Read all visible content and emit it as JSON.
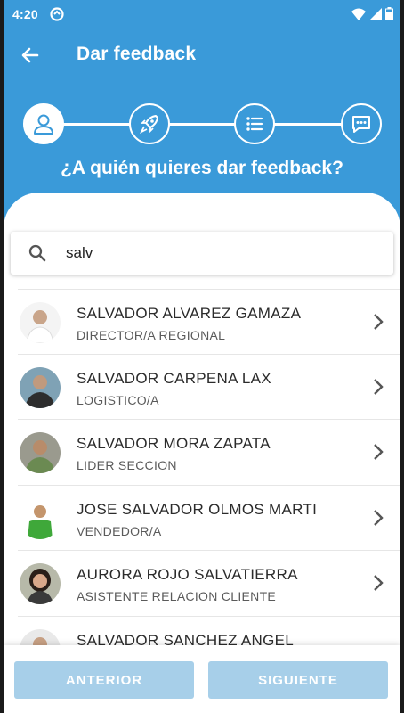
{
  "status_bar": {
    "time": "4:20"
  },
  "toolbar": {
    "title": "Dar feedback"
  },
  "stepper": {
    "steps": [
      {
        "icon": "person-icon",
        "active": true
      },
      {
        "icon": "rocket-icon",
        "active": false
      },
      {
        "icon": "list-icon",
        "active": false
      },
      {
        "icon": "chat-icon",
        "active": false
      }
    ]
  },
  "question": "¿A quién quieres dar feedback?",
  "search": {
    "value": "salv"
  },
  "people": [
    {
      "name": "SALVADOR ALVAREZ GAMAZA",
      "role": "DIRECTOR/A REGIONAL"
    },
    {
      "name": "SALVADOR CARPENA LAX",
      "role": "LOGISTICO/A"
    },
    {
      "name": "SALVADOR MORA ZAPATA",
      "role": "LIDER SECCION"
    },
    {
      "name": "JOSE SALVADOR OLMOS MARTI",
      "role": "VENDEDOR/A"
    },
    {
      "name": "AURORA ROJO SALVATIERRA",
      "role": "ASISTENTE RELACION CLIENTE"
    },
    {
      "name": "SALVADOR SANCHEZ ANGEL",
      "role": ""
    }
  ],
  "buttons": {
    "previous": "ANTERIOR",
    "next": "SIGUIENTE"
  },
  "colors": {
    "primary": "#3a9ad9",
    "button_disabled": "#a7cfe9"
  }
}
